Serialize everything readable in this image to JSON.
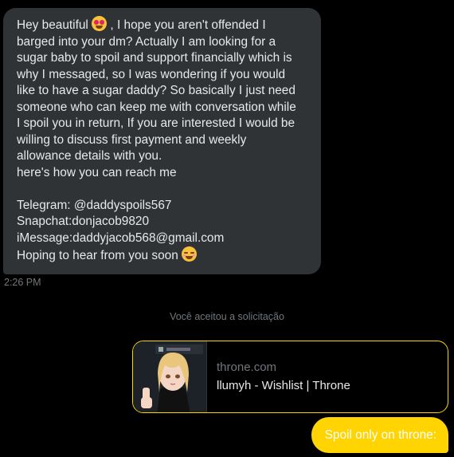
{
  "incoming_message": {
    "lines_part1": [
      "Hey beautiful",
      ", I hope you aren't offended I",
      "barged into your dm? Actually I am looking for a",
      "sugar baby to spoil and support financially which is",
      "why I messaged, so I was wondering if you would",
      "like to have a sugar daddy? So basically I just need",
      "someone who can keep me with conversation while",
      "I spoil you in return, If you are interested I would be",
      "willing to discuss first payment and weekly",
      "allowance details with you.",
      "here's how you can reach me"
    ],
    "lines_part2": [
      "Telegram: @daddyspoils567",
      "Snapchat:donjacob9820",
      "iMessage:daddyjacob568@gmail.com",
      "Hoping to hear from you soon"
    ],
    "emoji_1": "heart-eyes-emoji",
    "emoji_2": "smiling-face-emoji",
    "timestamp": "2:26 PM"
  },
  "system_notice": "Você aceitou a solicitação",
  "link_card": {
    "domain": "throne.com",
    "title": "llumyh - Wishlist | Throne",
    "border_color": "#ffd400"
  },
  "outgoing_message": {
    "text": "Spoil only on throne:",
    "bubble_color": "#ffd400"
  },
  "colors": {
    "background": "#000000",
    "incoming_bubble": "#2f3336",
    "muted_text": "#71767b"
  }
}
